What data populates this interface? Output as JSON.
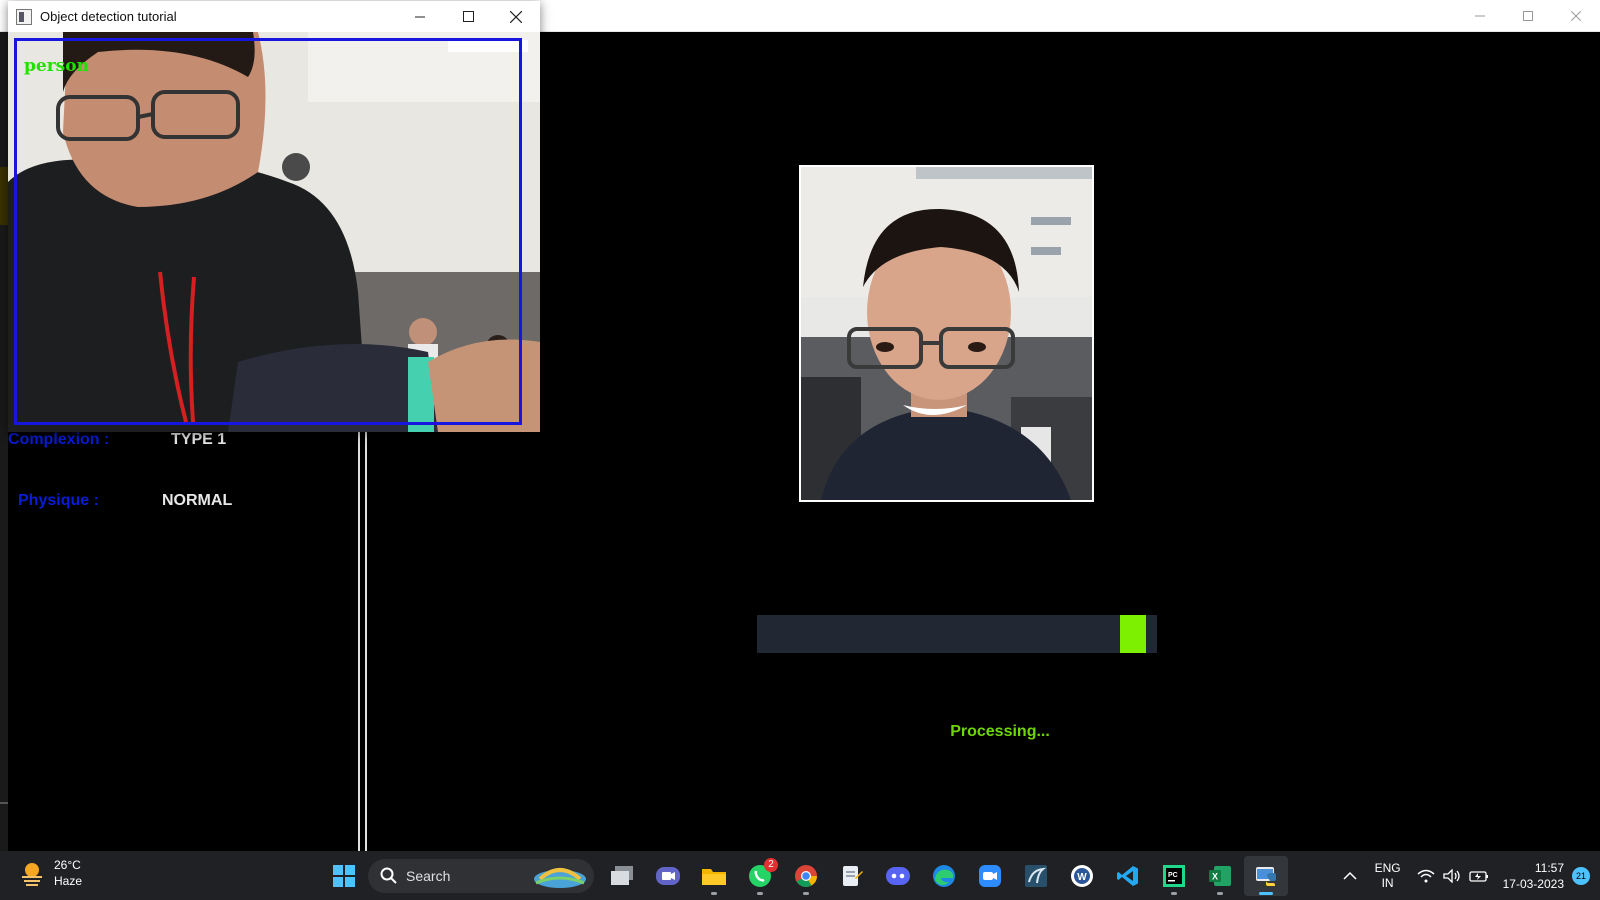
{
  "main_window": {
    "info": {
      "complexion_label": "Complexion :",
      "complexion_value": "TYPE 1",
      "physique_label": "Physique :",
      "physique_value": "NORMAL"
    },
    "progress": {
      "fraction": 0.97,
      "status": "Processing..."
    }
  },
  "camera_window": {
    "title": "Object detection tutorial",
    "detection_label": "person",
    "box_color": "#1616e0",
    "label_color": "#22e000"
  },
  "taskbar": {
    "weather": {
      "temperature": "26°C",
      "condition": "Haze",
      "icon": "sun-haze-icon"
    },
    "search_placeholder": "Search",
    "pinned_apps": [
      {
        "name": "start",
        "icon": "windows-start-icon"
      },
      {
        "name": "task-view",
        "icon": "task-view-icon"
      },
      {
        "name": "chat",
        "icon": "teams-chat-icon"
      },
      {
        "name": "file-explorer",
        "icon": "folder-icon"
      },
      {
        "name": "whatsapp",
        "icon": "whatsapp-icon",
        "badge": "2"
      },
      {
        "name": "chrome",
        "icon": "chrome-icon"
      },
      {
        "name": "notepad",
        "icon": "notepad-icon"
      },
      {
        "name": "discord",
        "icon": "discord-icon"
      },
      {
        "name": "edge",
        "icon": "edge-icon"
      },
      {
        "name": "zoom",
        "icon": "zoom-icon"
      },
      {
        "name": "mysql-workbench",
        "icon": "dolphin-icon"
      },
      {
        "name": "word",
        "icon": "word-icon"
      },
      {
        "name": "vscode",
        "icon": "vscode-icon"
      },
      {
        "name": "pycharm",
        "icon": "pycharm-icon"
      },
      {
        "name": "excel",
        "icon": "excel-icon"
      },
      {
        "name": "python",
        "icon": "python-icon"
      }
    ],
    "language": {
      "line1": "ENG",
      "line2": "IN"
    },
    "clock": {
      "time": "11:57",
      "date": "17-03-2023"
    },
    "notification_count": "21"
  },
  "colors": {
    "accent_green": "#7cf000",
    "label_blue": "#0a1cd6",
    "taskbar": "#202124",
    "progress_track": "#222833"
  }
}
